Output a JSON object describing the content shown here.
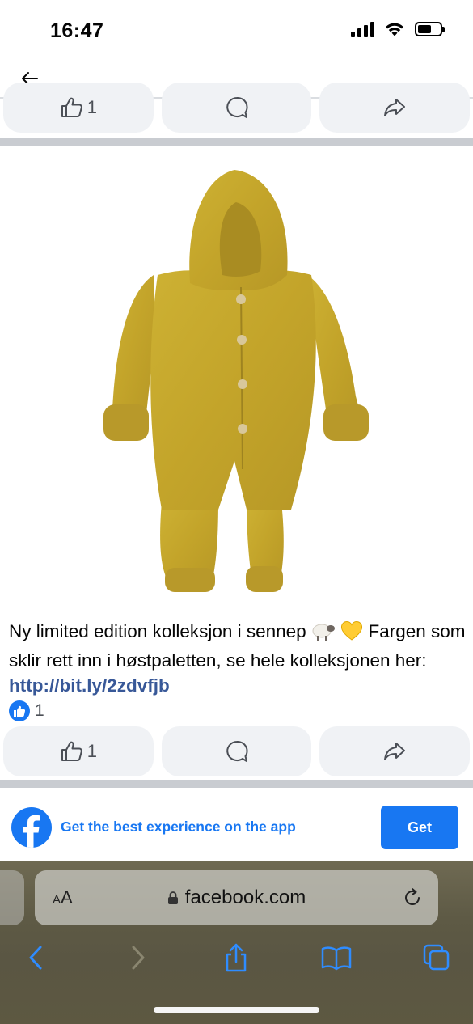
{
  "status_bar": {
    "time": "16:47",
    "icons": [
      "signal-icon",
      "wifi-icon",
      "battery-icon"
    ]
  },
  "top_nav": {
    "back_icon": "arrow-left-icon"
  },
  "previous_post_actions": {
    "like_count": "1",
    "icons": [
      "like-icon",
      "comment-icon",
      "share-icon"
    ]
  },
  "post": {
    "image_alt": "Mustard yellow wool baby overall with hood",
    "text_main": "Ny limited edition kolleksjon i sennep",
    "emojis": [
      "sheep-icon",
      "yellow-heart-icon"
    ],
    "text_after_emoji": "Fargen som sklir rett inn i høstpaletten, se hele kolleksjonen her:",
    "link": "http://bit.ly/2zdvfjb",
    "reaction_count": "1",
    "actions": {
      "like_count": "1",
      "icons": [
        "like-icon",
        "comment-icon",
        "share-icon"
      ]
    }
  },
  "app_banner": {
    "text": "Get the best experience on the app",
    "button_label": "Get",
    "logo": "facebook-logo-icon"
  },
  "safari": {
    "aa_label_small": "A",
    "aa_label_large": "A",
    "url": "facebook.com",
    "toolbar_icons": [
      "back-icon",
      "forward-icon",
      "share-icon",
      "bookmarks-icon",
      "tabs-icon"
    ]
  },
  "colors": {
    "facebook_blue": "#1877f2",
    "link_blue": "#385898",
    "action_bg": "#f0f2f5",
    "separator": "#c9ccd1",
    "mustard": "#c7a92c"
  }
}
